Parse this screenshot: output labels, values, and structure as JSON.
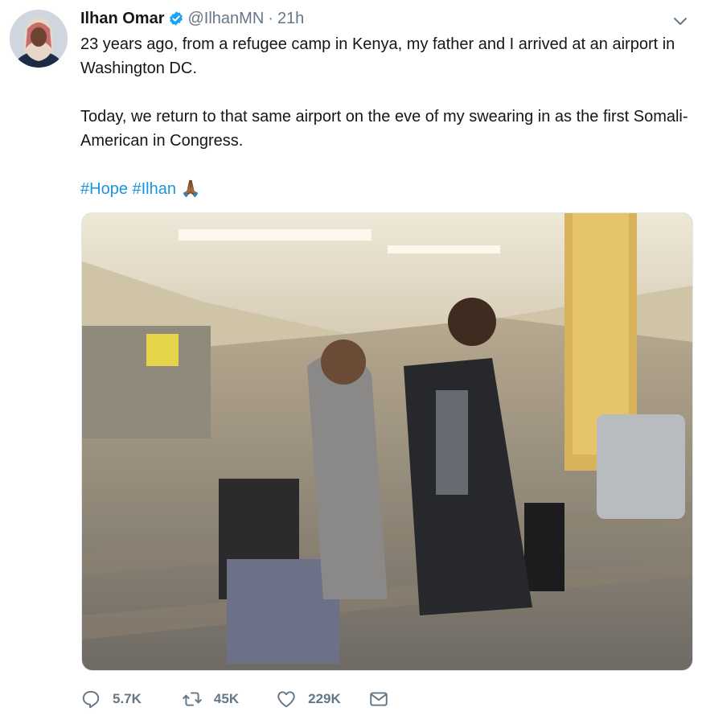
{
  "tweet": {
    "author_name": "Ilhan Omar",
    "handle": "@IlhanMN",
    "separator": "·",
    "time": "21h",
    "paragraph_1": "23 years ago, from a refugee camp in Kenya, my father and I arrived at an airport in Washington DC.",
    "paragraph_2": "Today, we return to that same airport on the eve of my swearing in as the first Somali-American in Congress.",
    "hashtags": [
      "#Hope",
      "#Ilhan"
    ],
    "emoji": "🙏🏾"
  },
  "actions": {
    "replies": "5.7K",
    "retweets": "45K",
    "likes": "229K"
  },
  "colors": {
    "text": "#14171a",
    "muted": "#657786",
    "link": "#1b95e0",
    "verified": "#1da1f2"
  },
  "icons": {
    "verified": "verified-badge-icon",
    "menu": "chevron-down-icon",
    "reply": "reply-icon",
    "retweet": "retweet-icon",
    "like": "heart-icon",
    "message": "envelope-icon"
  }
}
